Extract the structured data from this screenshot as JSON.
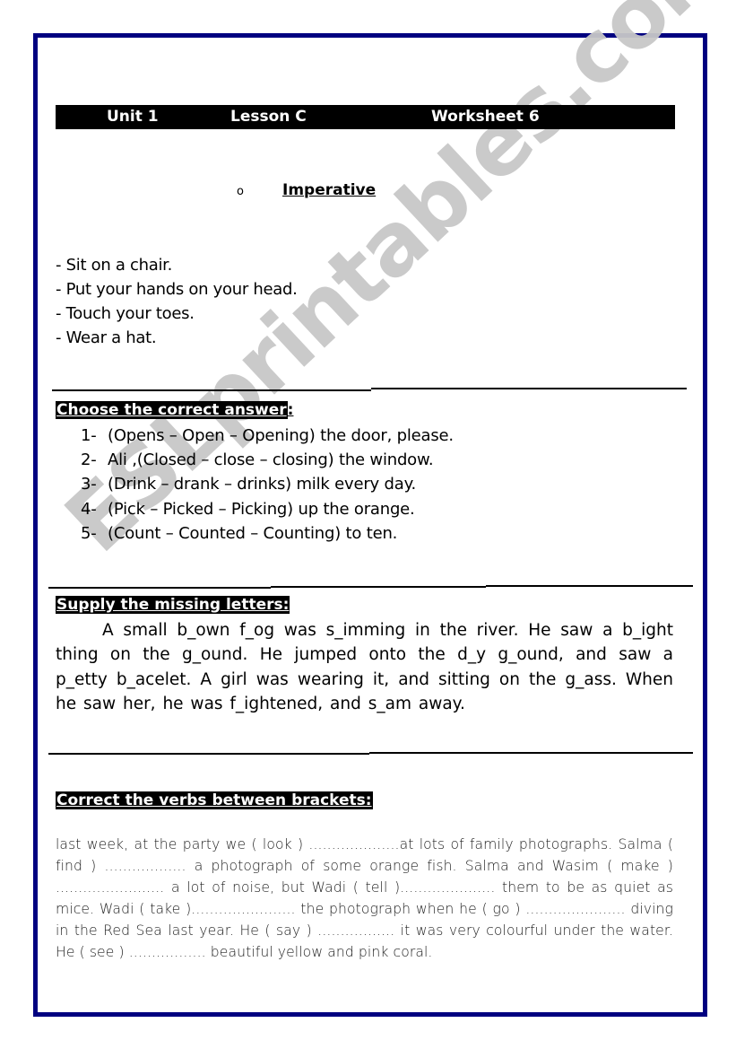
{
  "header": {
    "unit": "Unit 1",
    "lesson": "Lesson C",
    "worksheet": "Worksheet 6"
  },
  "topic": {
    "bullet": "o",
    "title": "Imperative"
  },
  "examples": [
    "- Sit on a chair.",
    "- Put your hands on your head.",
    "- Touch your toes.",
    "- Wear a hat."
  ],
  "section_choose": {
    "heading": "Choose the correct answer",
    "heading_tail": ":",
    "items": [
      {
        "num": "1-",
        "text": "(Opens – Open – Opening) the door, please."
      },
      {
        "num": "2-",
        "text": "Ali ,(Closed – close – closing) the window."
      },
      {
        "num": "3-",
        "text": "(Drink – drank – drinks) milk every day."
      },
      {
        "num": "4-",
        "text": "(Pick – Picked – Picking) up the orange."
      },
      {
        "num": "5-",
        "text": "(Count – Counted – Counting) to ten."
      }
    ]
  },
  "section_supply": {
    "heading": "Supply the missing letters:",
    "text": "A small b_own f_og was s_imming in the river. He saw a b_ight thing on the g_ound. He jumped onto the d_y g_ound, and saw a p_etty b_acelet. A girl was wearing it, and sitting on the g_ass. When he saw her, he was f_ightened, and s_am away."
  },
  "section_verbs": {
    "heading": "Correct the verbs between brackets:",
    "text": "last week, at the party we ( look ) ....................at lots of family photographs. Salma ( find ) .................. a photograph of some orange fish. Salma and Wasim ( make ) ........................ a lot of noise, but Wadi ( tell )..................... them to be as quiet as mice. Wadi ( take )....................... the photograph when he ( go ) ......................  diving in the Red Sea last year. He ( say ) ................. it was very colourful under the water. He ( see ) ................. beautiful yellow and pink coral."
  },
  "watermark": "ESLprintables.com",
  "colors": {
    "border": "#000080",
    "heading_bg": "#000000",
    "heading_fg": "#ffffff",
    "watermark": "#c8c8c8"
  }
}
